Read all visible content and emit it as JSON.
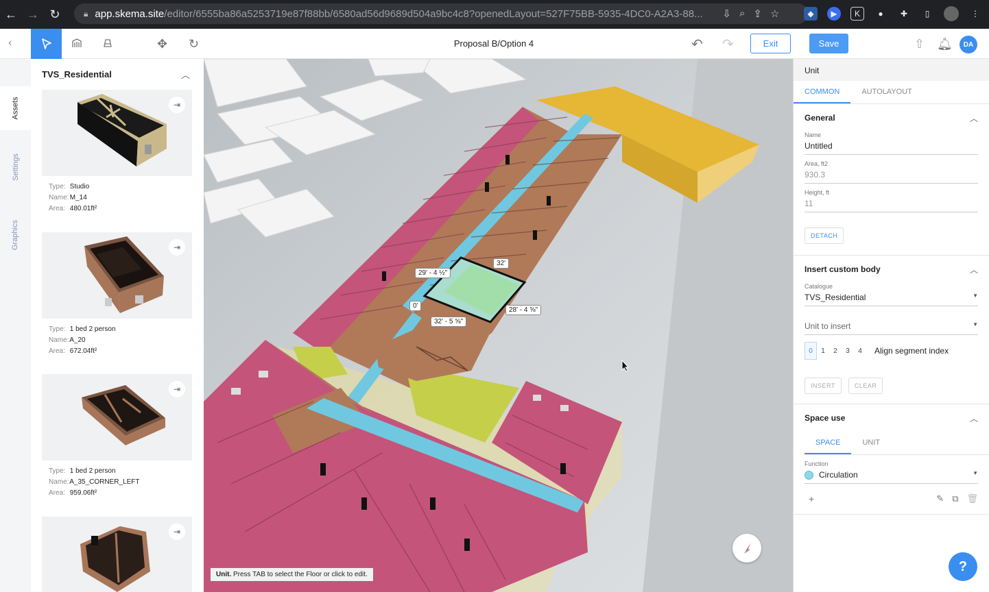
{
  "browser": {
    "url_domain": "app.skema.site",
    "url_path": "/editor/6555ba86a5253719e87f88bb/6580ad56d9689d504a9bc4c8?openedLayout=527F75BB-5935-4DC0-A2A3-88..."
  },
  "toolbar": {
    "title": "Proposal B/Option 4",
    "exit_label": "Exit",
    "save_label": "Save",
    "user_initials": "DA"
  },
  "side_tabs": {
    "assets": "Assets",
    "settings": "Settings",
    "graphics": "Graphics"
  },
  "assets": {
    "catalogue_title": "TVS_Residential",
    "labels": {
      "type": "Type:",
      "name": "Name:",
      "area": "Area:"
    },
    "items": [
      {
        "type": "Studio",
        "name": "M_14",
        "area": "480.01ft²"
      },
      {
        "type": "1 bed 2 person",
        "name": "A_20",
        "area": "672.04ft²"
      },
      {
        "type": "1 bed 2 person",
        "name": "A_35_CORNER_LEFT",
        "area": "959.06ft²"
      }
    ]
  },
  "viewport": {
    "status_bold": "Unit.",
    "status_text": " Press TAB to select the Floor or click to edit.",
    "dims": {
      "top": "32'",
      "left": "29' - 4 ½\"",
      "right": "28' - 4 ⅝\"",
      "bottom": "32' - 5 ⅝\"",
      "zero": "0'"
    }
  },
  "props": {
    "header": "Unit",
    "tabs": [
      "COMMON",
      "AUTOLAYOUT"
    ],
    "general": {
      "title": "General",
      "name_label": "Name",
      "name_value": "Untitled",
      "area_label": "Area, ft2",
      "area_value": "930.3",
      "height_label": "Height, ft",
      "height_value": "11",
      "detach": "DETACH"
    },
    "insert": {
      "title": "Insert custom body",
      "catalogue_label": "Catalogue",
      "catalogue_value": "TVS_Residential",
      "unit_placeholder": "Unit to insert",
      "segments": [
        "0",
        "1",
        "2",
        "3",
        "4"
      ],
      "align_label": "Align segment index",
      "insert_btn": "INSERT",
      "clear_btn": "CLEAR"
    },
    "space_use": {
      "title": "Space use",
      "tabs": [
        "SPACE",
        "UNIT"
      ],
      "function_label": "Function",
      "function_value": "Circulation",
      "function_color": "#8fd8e8"
    }
  },
  "colors": {
    "accent": "#3a8ef0",
    "residential_pink": "#c4547a",
    "unit_brown": "#b0795a",
    "corridor": "#6fc8e0",
    "yellow": "#e6b635",
    "green": "#c5cf4a"
  },
  "help_label": "?"
}
